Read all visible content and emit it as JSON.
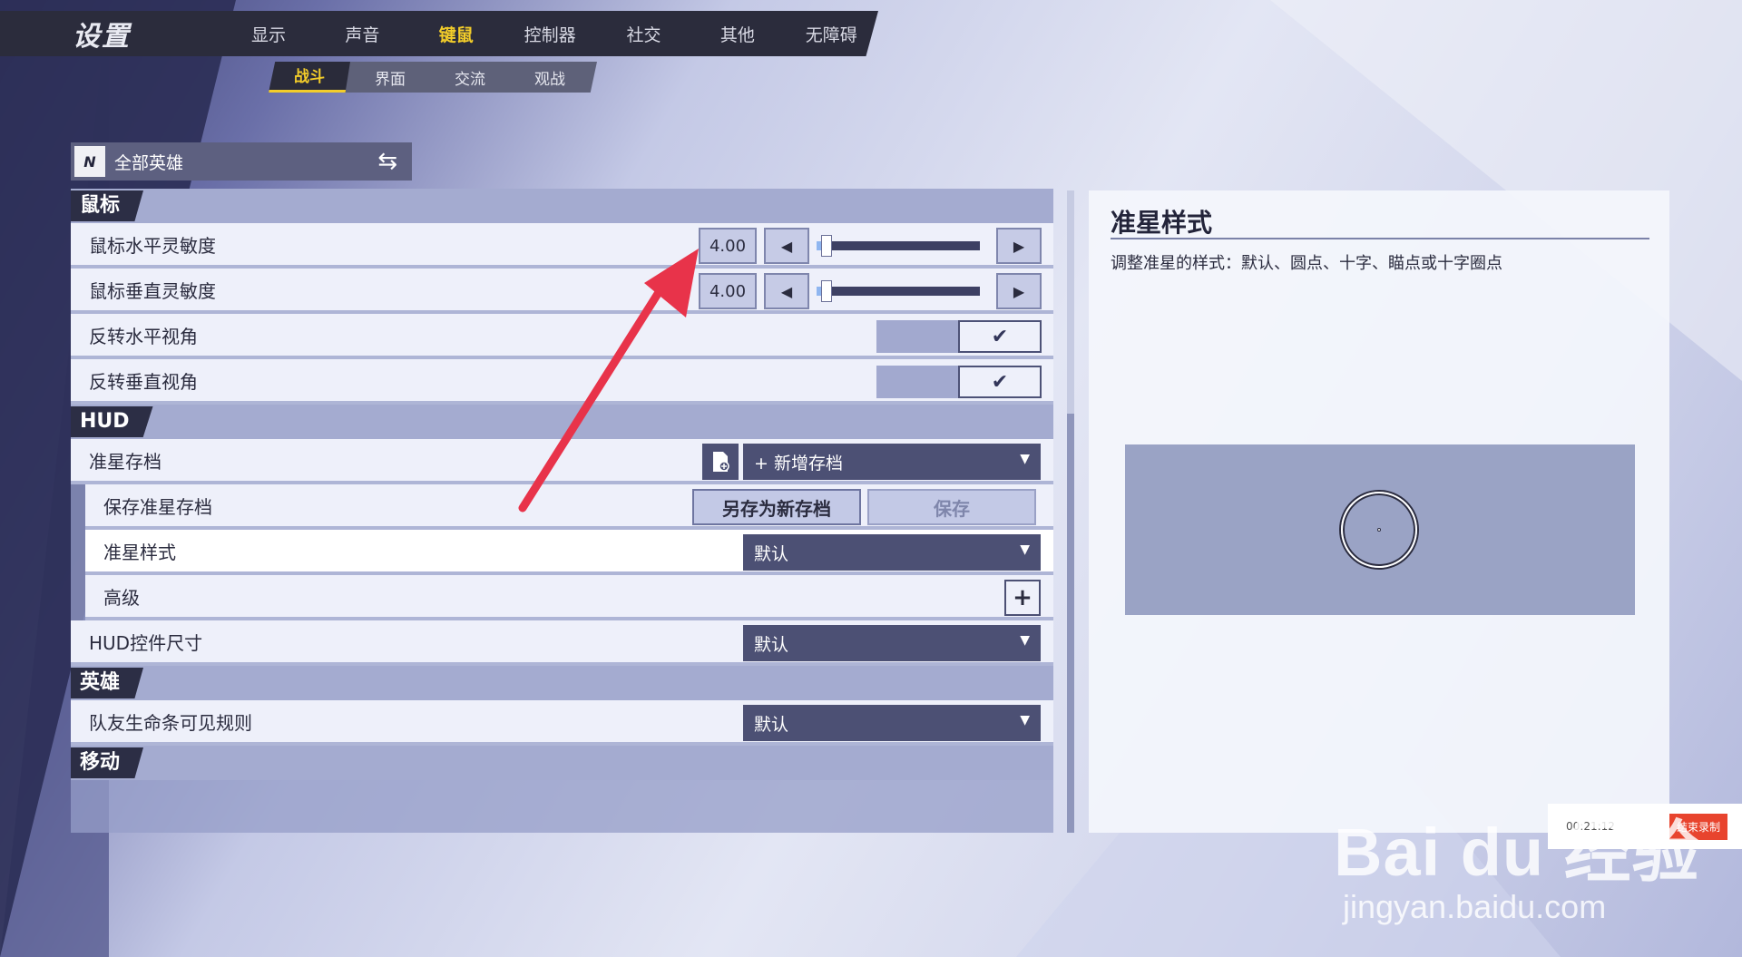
{
  "app": {
    "title": "设置"
  },
  "top_tabs": [
    {
      "label": "显示",
      "active": false
    },
    {
      "label": "声音",
      "active": false
    },
    {
      "label": "键鼠",
      "active": true
    },
    {
      "label": "控制器",
      "active": false
    },
    {
      "label": "社交",
      "active": false
    },
    {
      "label": "其他",
      "active": false
    },
    {
      "label": "无障碍",
      "active": false
    }
  ],
  "sub_tabs": [
    {
      "label": "战斗",
      "active": true
    },
    {
      "label": "界面",
      "active": false
    },
    {
      "label": "交流",
      "active": false
    },
    {
      "label": "观战",
      "active": false
    }
  ],
  "hero_selector": {
    "logo_text": "N",
    "label": "全部英雄",
    "swap_icon": "⇆"
  },
  "sections": {
    "mouse": {
      "title": "鼠标",
      "h_sens": {
        "label": "鼠标水平灵敏度",
        "value": "4.00",
        "slider_fraction": 0.06
      },
      "v_sens": {
        "label": "鼠标垂直灵敏度",
        "value": "4.00",
        "slider_fraction": 0.06
      },
      "invert_h": {
        "label": "反转水平视角",
        "checked": true
      },
      "invert_v": {
        "label": "反转垂直视角",
        "checked": true
      }
    },
    "hud": {
      "title": "HUD",
      "crosshair_profile": {
        "label": "准星存档",
        "value": "+ 新增存档"
      },
      "save_profile": {
        "label": "保存准星存档",
        "save_as": "另存为新存档",
        "save": "保存"
      },
      "crosshair_style": {
        "label": "准星样式",
        "value": "默认"
      },
      "advanced": {
        "label": "高级",
        "plus": "+"
      },
      "hud_size": {
        "label": "HUD控件尺寸",
        "value": "默认"
      }
    },
    "hero": {
      "title": "英雄",
      "teammate_health": {
        "label": "队友生命条可见规则",
        "value": "默认"
      }
    },
    "movement": {
      "title": "移动"
    }
  },
  "info_panel": {
    "title": "准星样式",
    "description": "调整准星的样式：默认、圆点、十字、瞄点或十字圈点"
  },
  "recording": {
    "time": "00:21:12",
    "stop_label": "结束录制"
  },
  "watermark": {
    "brand": "Bai du 经验",
    "url": "jingyan.baidu.com"
  },
  "icons": {
    "left": "◀",
    "right": "▶",
    "check": "✔",
    "caret": "▼",
    "save_file": "🖫"
  },
  "colors": {
    "accent": "#f3cd2a",
    "arrow": "#e8334a",
    "panel_dark": "#2b2c3c"
  }
}
